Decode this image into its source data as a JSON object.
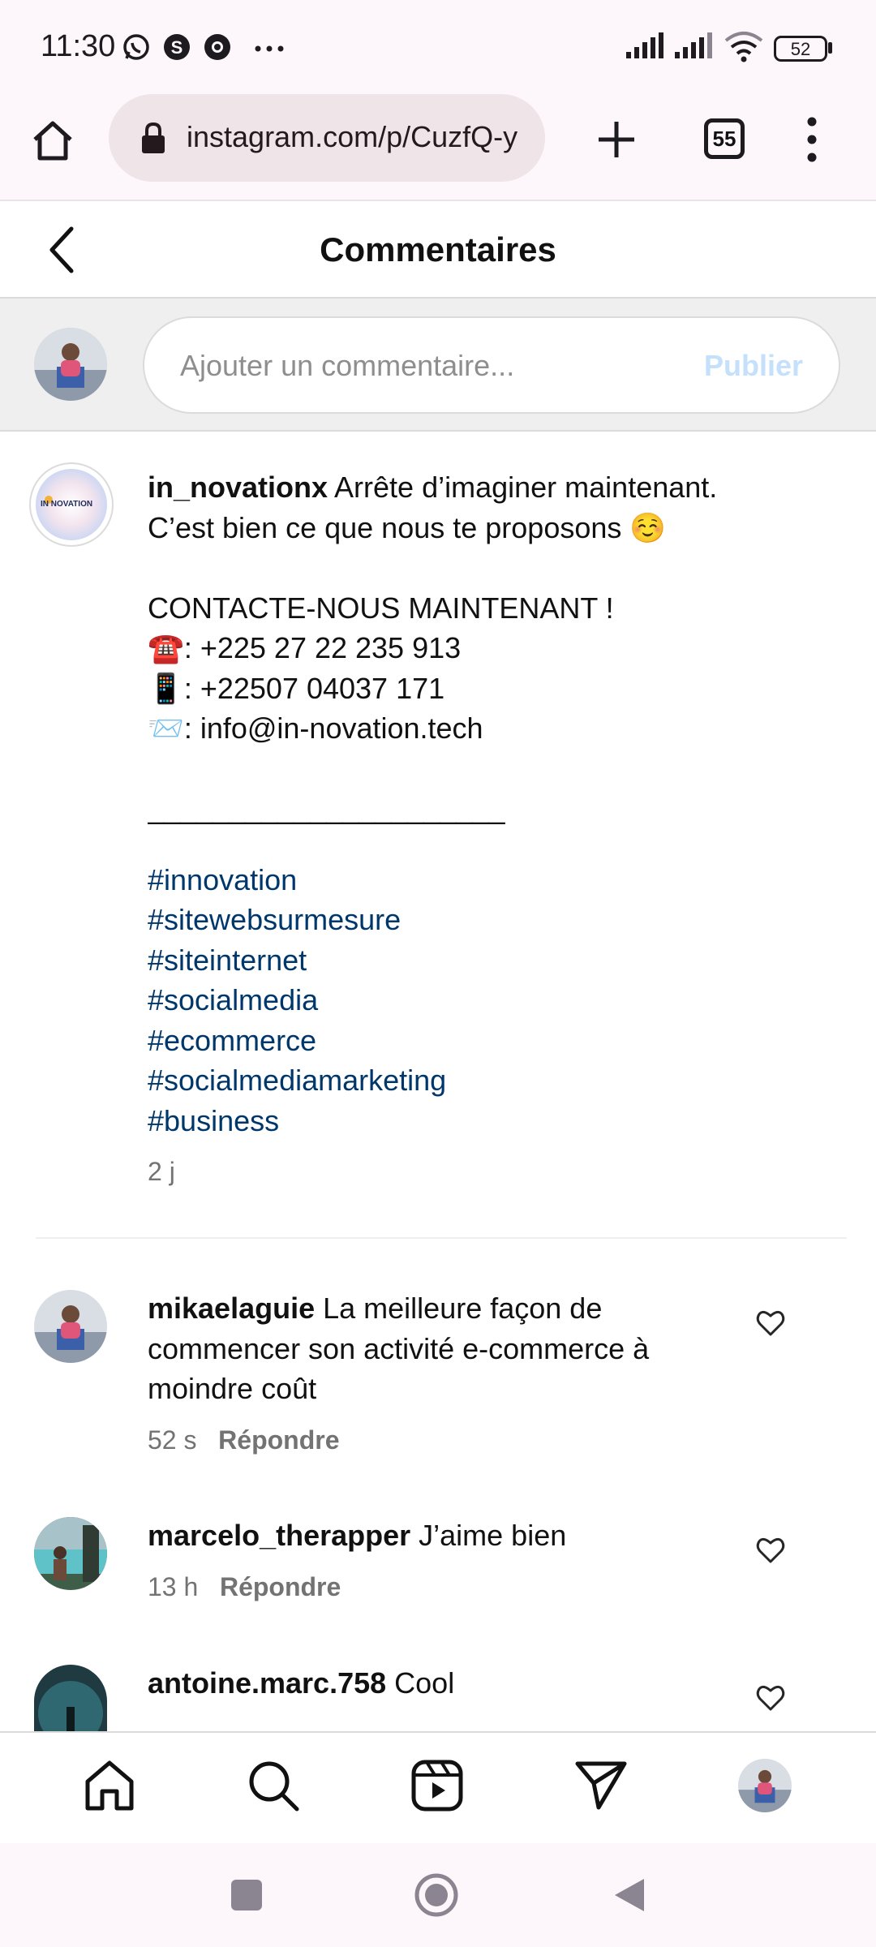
{
  "status_bar": {
    "time": "11:30",
    "battery": "52"
  },
  "browser": {
    "url": "instagram.com/p/CuzfQ-y",
    "tab_count": "55"
  },
  "header": {
    "title": "Commentaires"
  },
  "composer": {
    "placeholder": "Ajouter un commentaire...",
    "publish_label": "Publier"
  },
  "caption": {
    "username": "in_novationx",
    "line1": "Arrête d’imaginer maintenant.",
    "line2": "C’est bien ce que nous te proposons ☺️",
    "line3": "CONTACTE-NOUS MAINTENANT !",
    "phone1": "☎️: +225 27 22 235 913",
    "phone2": "📱: +22507 04037 171",
    "email": "📨: info@in-novation.tech",
    "divider": "______________________",
    "hashtags": [
      "#innovation",
      "#sitewebsurmesure",
      "#siteinternet",
      "#socialmedia",
      "#ecommerce",
      "#socialmediamarketing",
      "#business"
    ],
    "time": "2 j",
    "avatar_text": "IN NOVATION"
  },
  "comments": [
    {
      "username": "mikaelaguie",
      "text": "La meilleure façon de commencer son activité e-commerce à moindre coût",
      "time": "52 s",
      "reply": "Répondre"
    },
    {
      "username": "marcelo_therapper",
      "text": "J’aime bien",
      "time": "13 h",
      "reply": "Répondre"
    },
    {
      "username": "antoine.marc.758",
      "text": "Cool",
      "time": "",
      "reply": ""
    }
  ],
  "colors": {
    "link": "#00376b",
    "publish_disabled": "#c4e0fb",
    "muted": "#737373"
  }
}
